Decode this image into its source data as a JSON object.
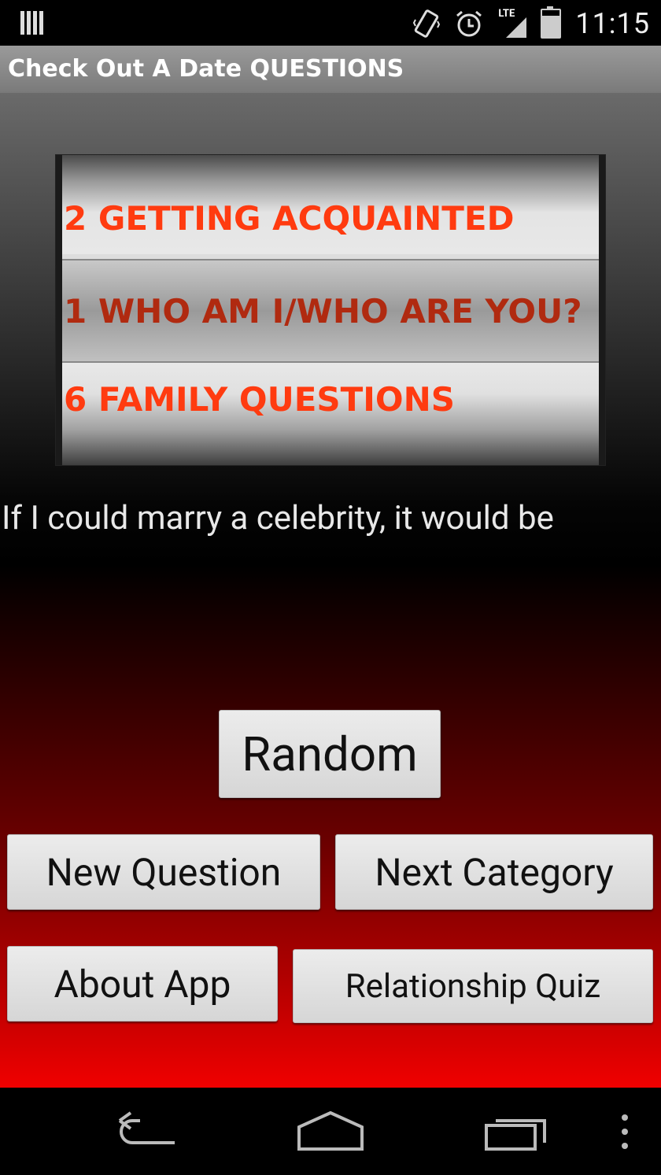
{
  "status_bar": {
    "time": "11:15",
    "network": "LTE",
    "icons": [
      "barcode-icon",
      "vibrate-icon",
      "alarm-icon",
      "signal-icon",
      "battery-icon"
    ]
  },
  "app": {
    "title": "Check Out A Date QUESTIONS"
  },
  "picker": {
    "items": [
      "2 GETTING ACQUAINTED",
      "1 WHO AM I/WHO ARE YOU?",
      "6 FAMILY QUESTIONS"
    ],
    "colors": {
      "item": "#ff3b10",
      "selected": "#b02a10"
    }
  },
  "question": "If I could marry a celebrity, it would be",
  "buttons": {
    "random": "Random",
    "new_question": "New Question",
    "next_category": "Next Category",
    "about_app": "About App",
    "relationship_quiz": "Relationship Quiz"
  },
  "nav": {
    "icons": [
      "back-icon",
      "home-icon",
      "recent-apps-icon",
      "menu-icon"
    ]
  }
}
